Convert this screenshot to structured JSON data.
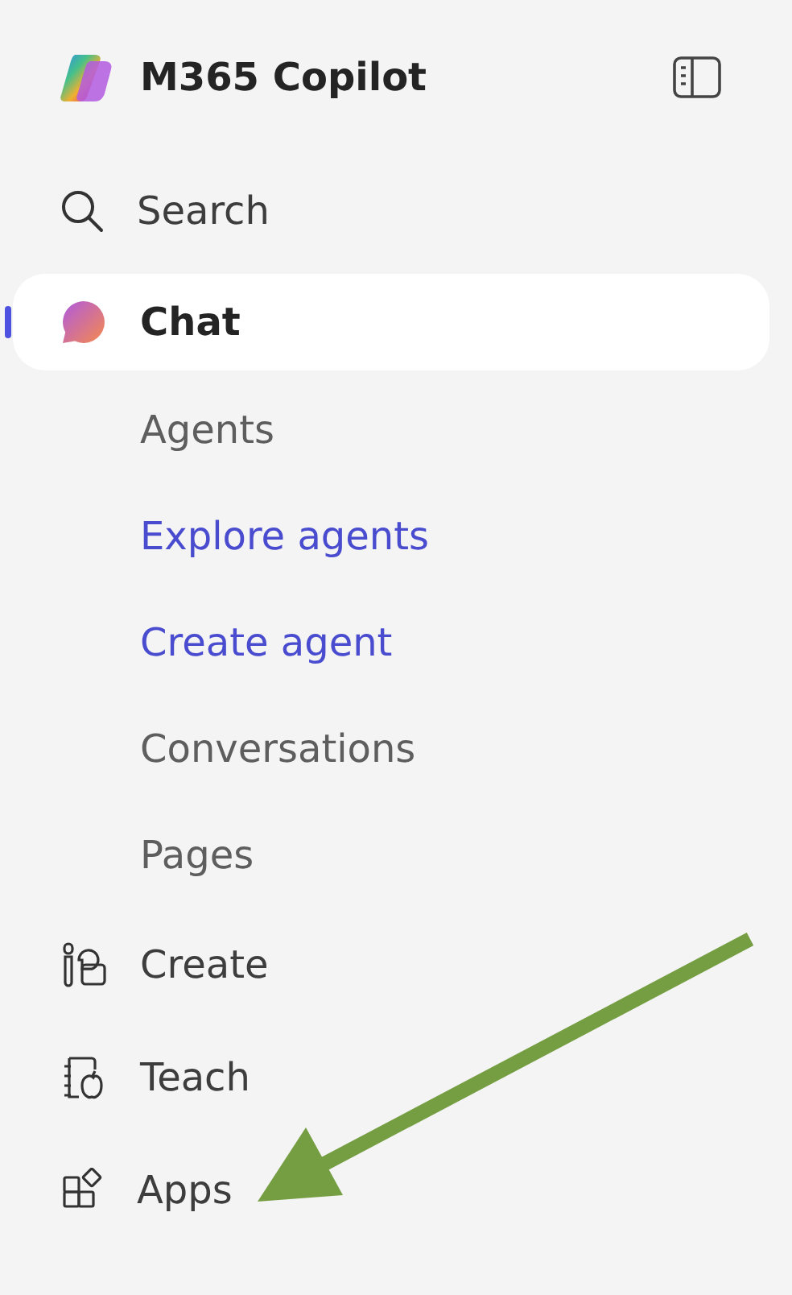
{
  "header": {
    "title": "M365 Copilot"
  },
  "nav": [
    {
      "kind": "search",
      "label": "Search",
      "selected": false
    },
    {
      "kind": "chat",
      "label": "Chat",
      "selected": true
    }
  ],
  "subnav": [
    {
      "kind": "section",
      "label": "Agents"
    },
    {
      "kind": "link",
      "label": "Explore agents"
    },
    {
      "kind": "link",
      "label": "Create agent"
    },
    {
      "kind": "section",
      "label": "Conversations"
    },
    {
      "kind": "section",
      "label": "Pages"
    }
  ],
  "tools": [
    {
      "kind": "create",
      "label": "Create",
      "selected": false
    },
    {
      "kind": "teach",
      "label": "Teach",
      "selected": false
    },
    {
      "kind": "apps",
      "label": "Apps",
      "selected": false
    }
  ]
}
